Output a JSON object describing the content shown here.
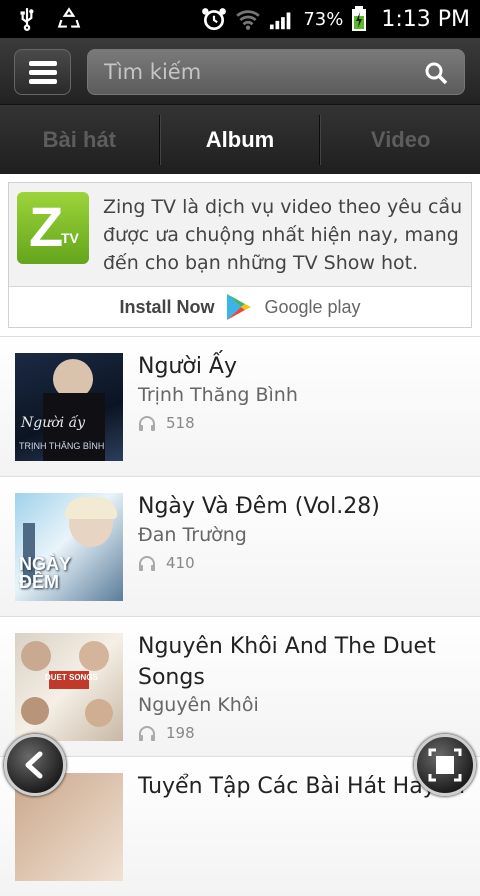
{
  "statusbar": {
    "battery_pct": "73%",
    "time": "1:13 PM"
  },
  "search": {
    "placeholder": "Tìm kiếm"
  },
  "tabs": [
    {
      "label": "Bài hát",
      "active": false
    },
    {
      "label": "Album",
      "active": true
    },
    {
      "label": "Video",
      "active": false
    }
  ],
  "ad": {
    "logo_text": "Z",
    "logo_sub": "TV",
    "text": "Zing TV là dịch vụ video theo yêu cầu được ưa chuộng nhất hiện nay, mang đến cho bạn những TV Show hot.",
    "install_label": "Install Now",
    "store_label": "Google play"
  },
  "albums": [
    {
      "title": "Người Ấy",
      "artist": "Trịnh Thăng Bình",
      "plays": "518",
      "cover_text": "TRỊNH THĂNG BÌNH",
      "cover_script": "Người ấy"
    },
    {
      "title": "Ngày Và Đêm (Vol.28)",
      "artist": "Đan Trường",
      "plays": "410",
      "cover_text": "NGÀY ĐÊM"
    },
    {
      "title": "Nguyên Khôi And The Duet Songs",
      "artist": "Nguyên Khôi",
      "plays": "198",
      "cover_text": "DUET SONGS"
    },
    {
      "title": "Tuyển Tập Các Bài Hát Hay Nhất",
      "artist": "",
      "plays": ""
    }
  ],
  "colors": {
    "accent_green": "#7cc22a",
    "topbar_bg": "#2d2d2d"
  }
}
